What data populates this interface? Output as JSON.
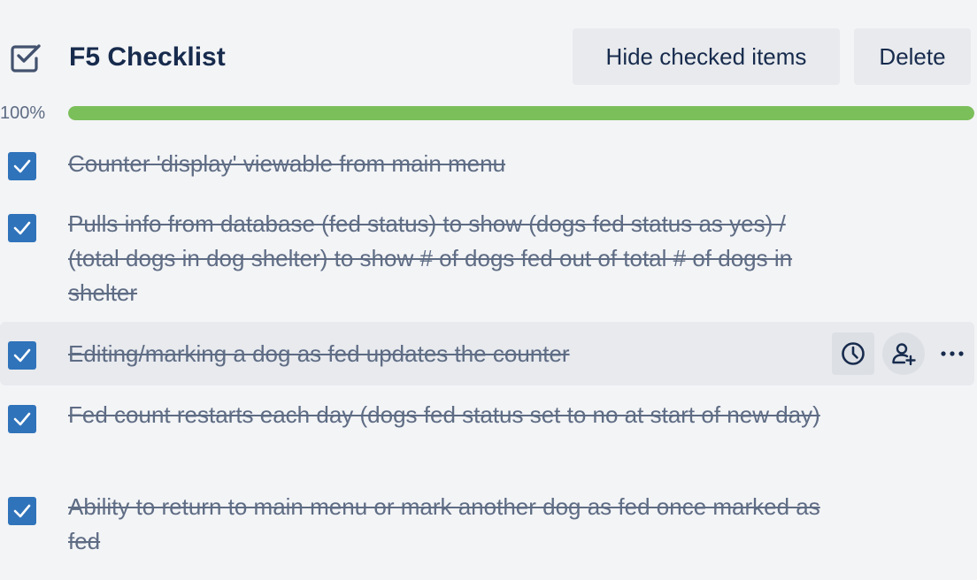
{
  "checklist": {
    "title": "F5 Checklist",
    "hide_checked_label": "Hide checked items",
    "delete_label": "Delete",
    "progress_text": "100%",
    "progress_value": 1.0,
    "progress_color": "#7bbf5a",
    "checkbox_color": "#2f73ba",
    "header_icon": "checklist-icon",
    "items": [
      {
        "text": "Counter 'display' viewable from main menu",
        "checked": true
      },
      {
        "text": "Pulls info from database (fed status) to show (dogs fed status as yes) / (total dogs in dog shelter) to show # of dogs fed out of total # of dogs in shelter",
        "checked": true
      },
      {
        "text": "Editing/marking a dog as fed updates the counter",
        "checked": true
      },
      {
        "text": "Fed count restarts each day (dogs fed status set to no at start of new day)",
        "checked": true
      },
      {
        "text": "Ability to return to main menu or mark another dog as fed once marked as fed",
        "checked": true
      }
    ],
    "item_actions": [
      "clock-icon",
      "add-member-icon",
      "more-icon"
    ]
  }
}
